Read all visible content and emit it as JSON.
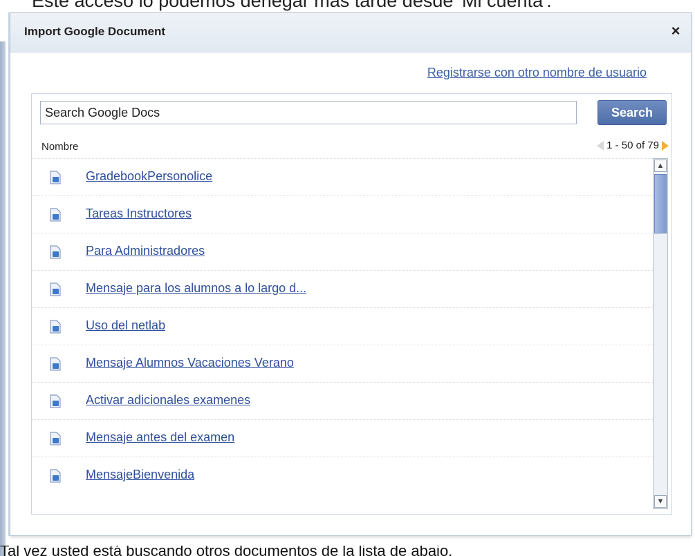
{
  "page": {
    "top_text": "Este acceso lo podemos denegar mas tarde desde 'Mi cuenta'.",
    "bottom_text": "Tal vez usted está buscando otros documentos de la lista de abajo."
  },
  "dialog": {
    "title": "Import Google Document",
    "close_label": "×",
    "alt_user_link": "Registrarse con otro nombre de usuario"
  },
  "search": {
    "value": "Search Google Docs",
    "button_label": "Search"
  },
  "list": {
    "column_header": "Nombre",
    "pager_text": "1 - 50 of 79",
    "items": [
      {
        "label": "GradebookPersonolice"
      },
      {
        "label": "Tareas Instructores"
      },
      {
        "label": "Para Administradores"
      },
      {
        "label": "Mensaje para los alumnos a lo largo d..."
      },
      {
        "label": "Uso del netlab"
      },
      {
        "label": "Mensaje Alumnos Vacaciones Verano"
      },
      {
        "label": "Activar adicionales examenes"
      },
      {
        "label": "Mensaje antes del examen"
      },
      {
        "label": "MensajeBienvenida"
      }
    ]
  },
  "icons": {
    "doc": "document-icon",
    "prev": "pager-prev-icon",
    "next": "pager-next-icon",
    "close": "close-icon"
  },
  "colors": {
    "link": "#2f4f9c",
    "button": "#5675ad",
    "pager_next": "#f0b23a"
  }
}
